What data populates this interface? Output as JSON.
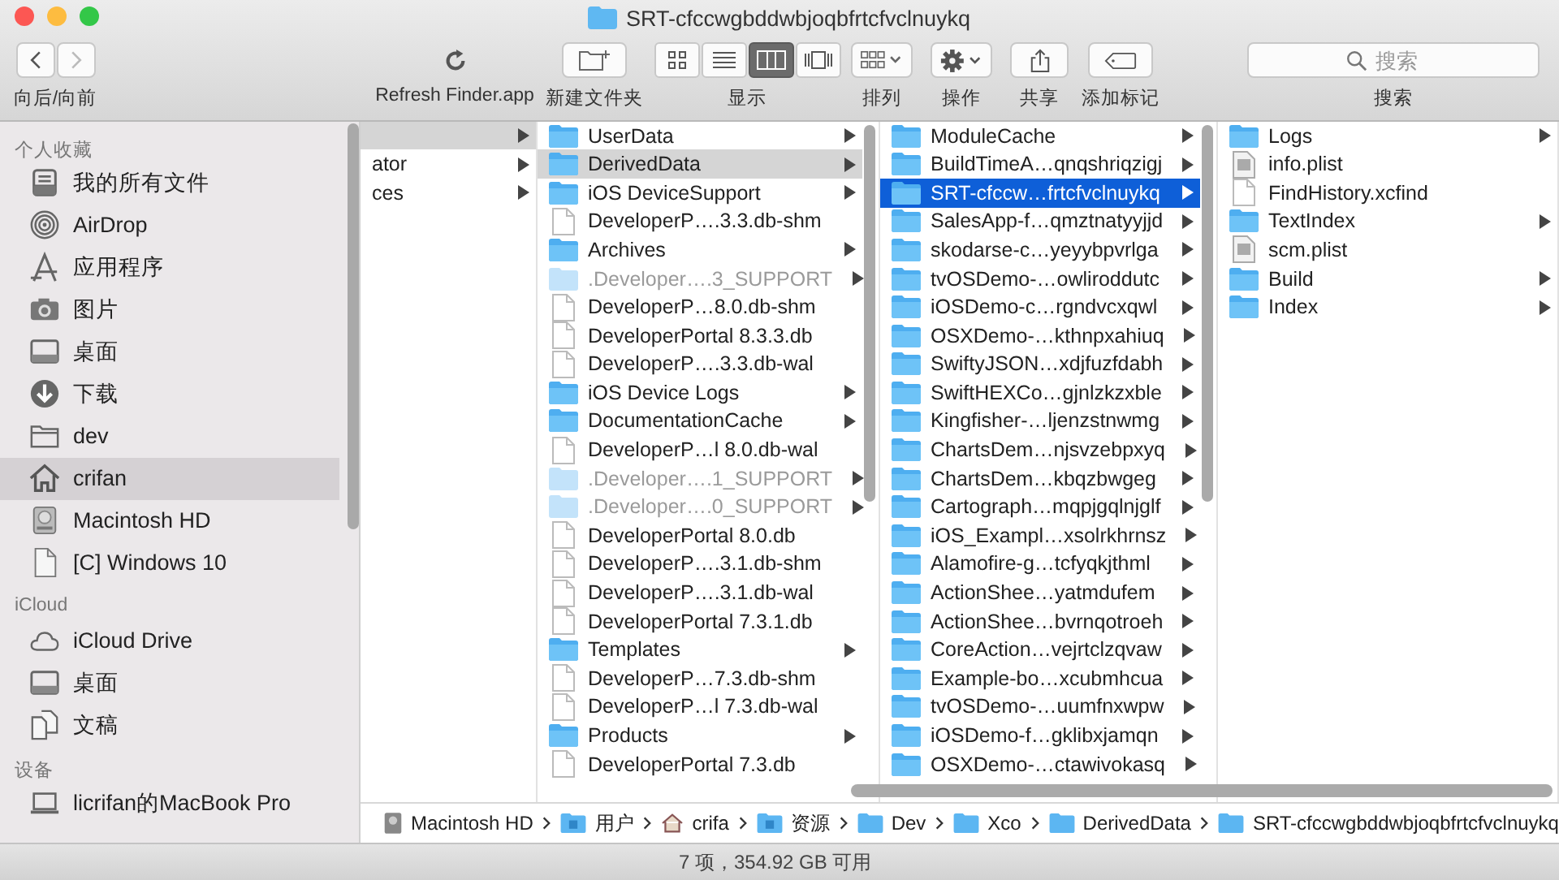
{
  "window": {
    "title": "SRT-cfccwgbddwbjoqbfrtcfvclnuykq"
  },
  "toolbar": {
    "back": {
      "disabled": false
    },
    "forward": {
      "disabled": true
    },
    "nav_label": "向后/向前",
    "refresh_label": "Refresh Finder.app",
    "new_folder_label": "新建文件夹",
    "view_label": "显示",
    "view_modes": [
      {
        "kind": "icons",
        "selected": false
      },
      {
        "kind": "list",
        "selected": false
      },
      {
        "kind": "columns",
        "selected": true
      },
      {
        "kind": "gallery",
        "selected": false
      }
    ],
    "arrange_label": "排列",
    "action_label": "操作",
    "share_label": "共享",
    "tags_label": "添加标记",
    "search": {
      "placeholder": "搜索",
      "label": "搜索"
    }
  },
  "sidebar": [
    {
      "title": "个人收藏",
      "items": [
        {
          "name": "我的所有文件",
          "kind": "recents",
          "selected": false
        },
        {
          "name": "AirDrop",
          "kind": "airdrop",
          "selected": false
        },
        {
          "name": "应用程序",
          "kind": "apps",
          "selected": false
        },
        {
          "name": "图片",
          "kind": "camera",
          "selected": false
        },
        {
          "name": "桌面",
          "kind": "desktop",
          "selected": false
        },
        {
          "name": "下载",
          "kind": "download",
          "selected": false
        },
        {
          "name": "dev",
          "kind": "folder",
          "selected": false
        },
        {
          "name": "crifan",
          "kind": "home",
          "selected": true
        },
        {
          "name": "Macintosh HD",
          "kind": "disk",
          "selected": false
        },
        {
          "name": "[C] Windows 10",
          "kind": "file",
          "selected": false
        }
      ]
    },
    {
      "title": "iCloud",
      "items": [
        {
          "name": "iCloud Drive",
          "kind": "cloud",
          "selected": false
        },
        {
          "name": "桌面",
          "kind": "desktop",
          "selected": false
        },
        {
          "name": "文稿",
          "kind": "documents",
          "selected": false
        }
      ]
    },
    {
      "title": "设备",
      "items": [
        {
          "name": "licrifan的MacBook Pro",
          "kind": "laptop",
          "selected": false
        }
      ]
    }
  ],
  "columns": [
    {
      "focused": false,
      "items": [
        {
          "kind": "cut",
          "selected": true
        },
        {
          "name": "ator",
          "kind": "cut",
          "selected": false
        },
        {
          "name": "ces",
          "kind": "cut",
          "selected": false
        }
      ]
    },
    {
      "focused": false,
      "items": [
        {
          "name": "UserData",
          "kind": "folder",
          "selected": false
        },
        {
          "name": "DerivedData",
          "kind": "folder",
          "selected": true
        },
        {
          "name": "iOS DeviceSupport",
          "kind": "folder",
          "selected": false
        },
        {
          "name": "DeveloperP….3.3.db-shm",
          "kind": "file",
          "selected": false
        },
        {
          "name": "Archives",
          "kind": "folder",
          "selected": false
        },
        {
          "name": ".Developer….3_SUPPORT",
          "kind": "hidden-folder",
          "selected": false
        },
        {
          "name": "DeveloperP…8.0.db-shm",
          "kind": "file",
          "selected": false
        },
        {
          "name": "DeveloperPortal 8.3.3.db",
          "kind": "file",
          "selected": false
        },
        {
          "name": "DeveloperP….3.3.db-wal",
          "kind": "file",
          "selected": false
        },
        {
          "name": "iOS Device Logs",
          "kind": "folder",
          "selected": false
        },
        {
          "name": "DocumentationCache",
          "kind": "folder",
          "selected": false
        },
        {
          "name": "DeveloperP…l 8.0.db-wal",
          "kind": "file",
          "selected": false
        },
        {
          "name": ".Developer….1_SUPPORT",
          "kind": "hidden-folder",
          "selected": false
        },
        {
          "name": ".Developer….0_SUPPORT",
          "kind": "hidden-folder",
          "selected": false
        },
        {
          "name": "DeveloperPortal 8.0.db",
          "kind": "file",
          "selected": false
        },
        {
          "name": "DeveloperP….3.1.db-shm",
          "kind": "file",
          "selected": false
        },
        {
          "name": "DeveloperP….3.1.db-wal",
          "kind": "file",
          "selected": false
        },
        {
          "name": "DeveloperPortal 7.3.1.db",
          "kind": "file",
          "selected": false
        },
        {
          "name": "Templates",
          "kind": "folder",
          "selected": false
        },
        {
          "name": "DeveloperP…7.3.db-shm",
          "kind": "file",
          "selected": false
        },
        {
          "name": "DeveloperP…l 7.3.db-wal",
          "kind": "file",
          "selected": false
        },
        {
          "name": "Products",
          "kind": "folder",
          "selected": false
        },
        {
          "name": "DeveloperPortal 7.3.db",
          "kind": "file",
          "selected": false
        }
      ]
    },
    {
      "focused": true,
      "items": [
        {
          "name": "ModuleCache",
          "kind": "folder",
          "selected": false
        },
        {
          "name": "BuildTimeA…qnqshriqzigj",
          "kind": "folder",
          "selected": false
        },
        {
          "name": "SRT-cfccw…frtcfvclnuykq",
          "kind": "folder",
          "selected": true
        },
        {
          "name": "SalesApp-f…qmztnatyyjjd",
          "kind": "folder",
          "selected": false
        },
        {
          "name": "skodarse-c…yeyybpvrlga",
          "kind": "folder",
          "selected": false
        },
        {
          "name": "tvOSDemo-…owliroddutc",
          "kind": "folder",
          "selected": false
        },
        {
          "name": "iOSDemo-c…rgndvcxqwl",
          "kind": "folder",
          "selected": false
        },
        {
          "name": "OSXDemo-…kthnpxahiuq",
          "kind": "folder",
          "selected": false
        },
        {
          "name": "SwiftyJSON…xdjfuzfdabh",
          "kind": "folder",
          "selected": false
        },
        {
          "name": "SwiftHEXCo…gjnlzkzxble",
          "kind": "folder",
          "selected": false
        },
        {
          "name": "Kingfisher-…ljenzstnwmg",
          "kind": "folder",
          "selected": false
        },
        {
          "name": "ChartsDem…njsvzebpxyq",
          "kind": "folder",
          "selected": false
        },
        {
          "name": "ChartsDem…kbqzbwgeg",
          "kind": "folder",
          "selected": false
        },
        {
          "name": "Cartograph…mqpjgqlnjglf",
          "kind": "folder",
          "selected": false
        },
        {
          "name": "iOS_Exampl…xsolrkhrnsz",
          "kind": "folder",
          "selected": false
        },
        {
          "name": "Alamofire-g…tcfyqkjthml",
          "kind": "folder",
          "selected": false
        },
        {
          "name": "ActionShee…yatmdufem",
          "kind": "folder",
          "selected": false
        },
        {
          "name": "ActionShee…bvrnqotroeh",
          "kind": "folder",
          "selected": false
        },
        {
          "name": "CoreAction…vejrtclzqvaw",
          "kind": "folder",
          "selected": false
        },
        {
          "name": "Example-bo…xcubmhcua",
          "kind": "folder",
          "selected": false
        },
        {
          "name": "tvOSDemo-…uumfnxwpw",
          "kind": "folder",
          "selected": false
        },
        {
          "name": "iOSDemo-f…gklibxjamqn",
          "kind": "folder",
          "selected": false
        },
        {
          "name": "OSXDemo-…ctawivokasq",
          "kind": "folder",
          "selected": false
        }
      ]
    },
    {
      "items": [
        {
          "name": "Logs",
          "kind": "folder",
          "selected": false
        },
        {
          "name": "info.plist",
          "kind": "plist",
          "selected": false
        },
        {
          "name": "FindHistory.xcfind",
          "kind": "file",
          "selected": false
        },
        {
          "name": "TextIndex",
          "kind": "folder",
          "selected": false
        },
        {
          "name": "scm.plist",
          "kind": "plist",
          "selected": false
        },
        {
          "name": "Build",
          "kind": "folder",
          "selected": false
        },
        {
          "name": "Index",
          "kind": "folder",
          "selected": false
        }
      ]
    }
  ],
  "path": [
    {
      "name": "Macintosh HD",
      "kind": "disk"
    },
    {
      "name": "用户",
      "kind": "users"
    },
    {
      "name": "crifa",
      "kind": "home"
    },
    {
      "name": "资源",
      "kind": "library"
    },
    {
      "name": "Dev",
      "kind": "folder"
    },
    {
      "name": "Xco",
      "kind": "folder"
    },
    {
      "name": "DerivedData",
      "kind": "folder"
    },
    {
      "name": "SRT-cfccwgbddwbjoqbfrtcfvclnuykq",
      "kind": "folder"
    }
  ],
  "status": "7 项，354.92 GB 可用"
}
